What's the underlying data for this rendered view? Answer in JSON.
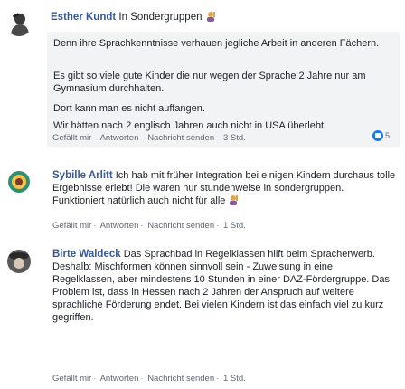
{
  "comments": [
    {
      "author": "Esther Kundt",
      "group_label": "In Sondergruppen",
      "avatar_icon": "person-with-headband-avatar",
      "paragraphs": [
        "Denn ihre Sprachkenntnisse verhauen jegliche Arbeit in anderen Fächern.",
        "Es gibt so viele gute Kinder die nur wegen der Sprache 2 Jahre nur am Gymnasium durchhalten.",
        "Dort kann man es nicht auffangen.",
        "Wir hätten nach 2 englisch Jahren auch nicht in USA überlebt!"
      ],
      "actions": {
        "like": "Gefällt mir",
        "reply": "Antworten",
        "message": "Nachricht senden",
        "time": "3 Std."
      },
      "reaction_count": "5"
    },
    {
      "author": "Sybille Arlitt",
      "text": "Ich hab mit früher Integration bei einigen Kindern durchaus tolle Ergebnisse erlebt! Die waren nur stundenweise in sondergruppen. Funktioniert natürlich auch nicht für alle",
      "avatar_icon": "flower-avatar",
      "actions": {
        "like": "Gefällt mir",
        "reply": "Antworten",
        "message": "Nachricht senden",
        "time": "1 Std."
      }
    },
    {
      "author": "Birte Waldeck",
      "text": "Das Sprachbad in Regelklassen hilft beim Spracherwerb. Deshalb: Mischformen können sinnvoll sein - Zuweisung in eine Regelklassen, aber mindestens 10 Stunden in einer DAZ-Fördergruppe. Das Problem ist, dass in Hessen nach 2 Jahren der Anspruch auf weitere sprachliche Förderung endet. Bei vielen Kindern ist das einfach viel zu kurz gegriffen.",
      "avatar_icon": "person-with-hat-avatar",
      "actions": {
        "like": "Gefällt mir",
        "reply": "Antworten",
        "message": "Nachricht senden",
        "time": "1 Std."
      }
    }
  ],
  "colors": {
    "author": "#385898",
    "bubble": "#f2f3f5",
    "meta": "#616770",
    "like": "#1877f2"
  }
}
